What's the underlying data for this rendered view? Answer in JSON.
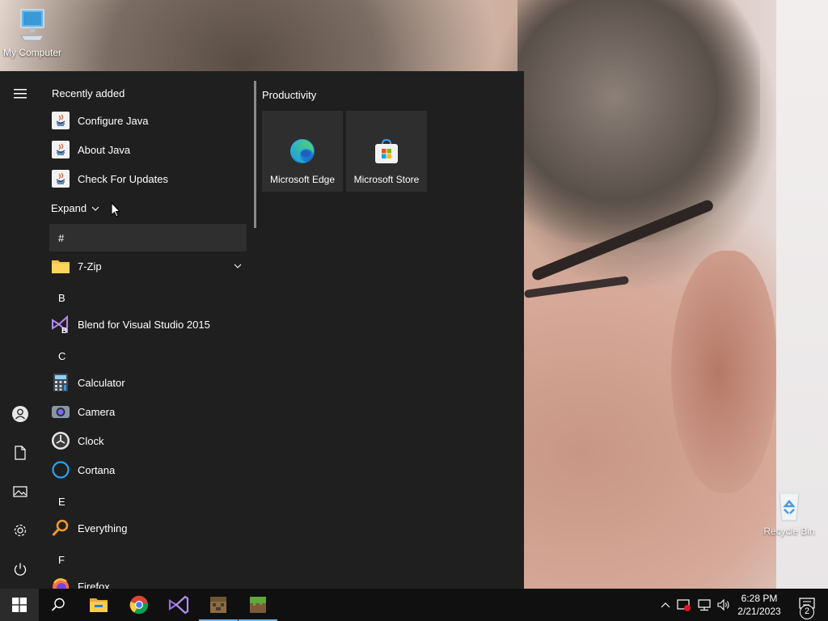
{
  "desktop": {
    "icons": [
      {
        "label": "My Computer"
      },
      {
        "label": "Recycle Bin"
      }
    ]
  },
  "start_menu": {
    "recently_added_label": "Recently added",
    "recent_apps": [
      {
        "label": "Configure Java",
        "icon": "java-icon"
      },
      {
        "label": "About Java",
        "icon": "java-icon"
      },
      {
        "label": "Check For Updates",
        "icon": "java-icon"
      }
    ],
    "expand_label": "Expand",
    "groups": {
      "hash": "#",
      "b": "B",
      "c": "C",
      "e": "E",
      "f": "F"
    },
    "apps": {
      "seven_zip": "7-Zip",
      "blend": "Blend for Visual Studio 2015",
      "calculator": "Calculator",
      "camera": "Camera",
      "clock": "Clock",
      "cortana": "Cortana",
      "everything": "Everything",
      "firefox": "Firefox"
    },
    "tiles_group_label": "Productivity",
    "tiles": [
      {
        "label": "Microsoft Edge",
        "icon": "edge-icon"
      },
      {
        "label": "Microsoft Store",
        "icon": "store-icon"
      }
    ],
    "rail": [
      "menu-icon",
      "user-icon",
      "document-icon",
      "pictures-icon",
      "settings-icon",
      "power-icon"
    ]
  },
  "taskbar": {
    "pinned": [
      "start-icon",
      "search-icon",
      "file-explorer-icon",
      "chrome-icon",
      "visual-studio-icon",
      "minecraft-launcher-icon",
      "minecraft-icon"
    ],
    "tray": [
      "chevron-up-icon",
      "security-icon",
      "network-icon",
      "volume-icon"
    ],
    "time": "6:28 PM",
    "date": "2/21/2023",
    "notification_count": "2"
  },
  "colors": {
    "start_bg": "#1f1f1f",
    "taskbar_bg": "#101010",
    "active_indicator": "#76b9ed"
  }
}
